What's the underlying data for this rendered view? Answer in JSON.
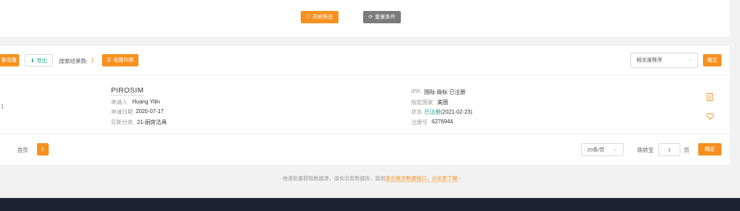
{
  "filter": {
    "start_label": "开始筛选",
    "reset_label": "重置条件"
  },
  "toolbar": {
    "bulk_collect_label": "量收藏",
    "export_label": "导出",
    "result_count_label": "搜索结果数:",
    "result_count": "1",
    "favorites_label": "收藏列表",
    "sort_value": "相关度降序",
    "confirm_label": "确定"
  },
  "result": {
    "index": "1",
    "title": "PIROSIM",
    "applicant_label": "申请人",
    "applicant": "Huang Yilin",
    "apply_date_label": "申请日期",
    "apply_date": "2020-07-17",
    "nice_class_label": "尼斯分类",
    "nice_class": "21-厨房洁具",
    "ipr_label": "IPR",
    "ipr": "国际 商标 已注册",
    "country_label": "指定国家",
    "country": "美国",
    "status_label": "状态",
    "status_text": "已注册",
    "status_date": "(2021-02-23)",
    "reg_no_label": "注册号",
    "reg_no": "6276944"
  },
  "pagination": {
    "first_label": "首页",
    "current_page": "1",
    "page_size": "20条/页",
    "goto_label": "跳转至",
    "goto_value": "1",
    "page_unit": "页",
    "confirm_label": "确定"
  },
  "footer": {
    "text": "- 快速批量获取数据源，填充自家数据库，就用",
    "link": "爱企精灵数据接口，点这里了解",
    "suffix": " -"
  },
  "colors": {
    "accent": "#f7901e",
    "green": "#16a38a",
    "dark": "#1d2131"
  }
}
